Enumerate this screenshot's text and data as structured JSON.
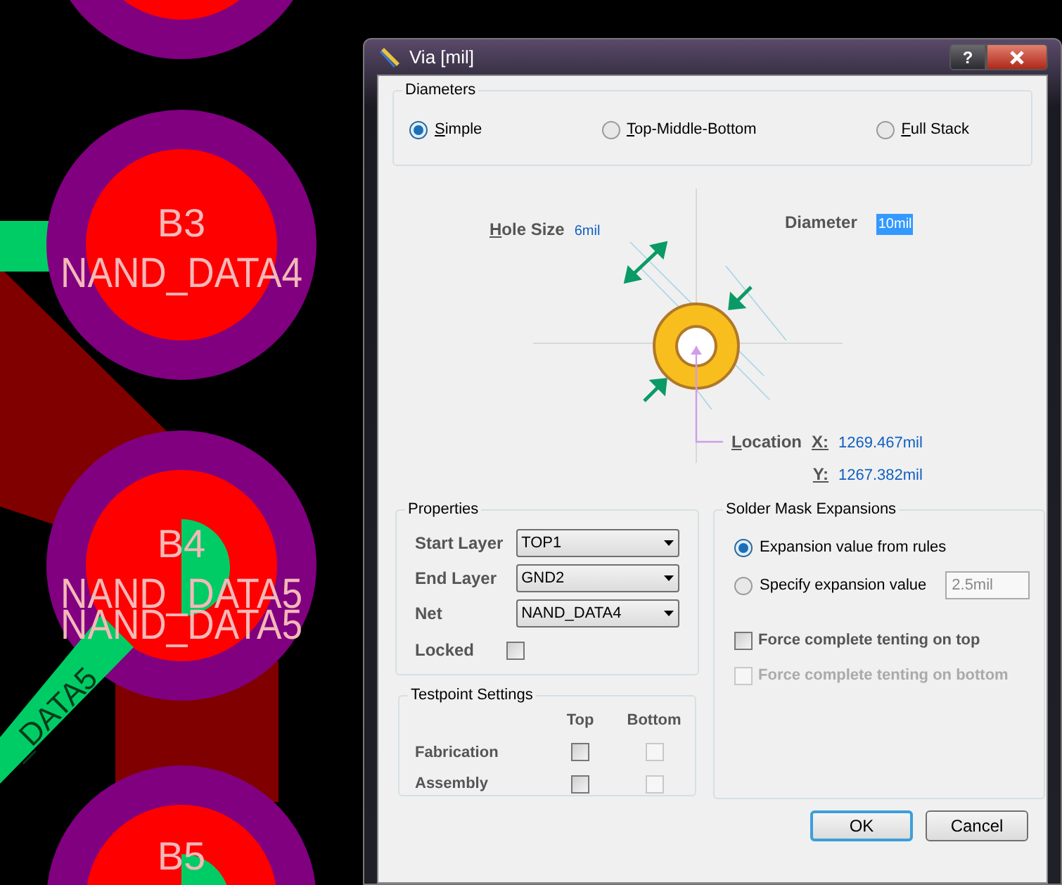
{
  "pcb": {
    "pads": [
      {
        "designator": "B3",
        "nets": [
          "NAND_DATA4"
        ]
      },
      {
        "designator": "B4",
        "nets": [
          "NAND_DATA5",
          "NAND_DATA5"
        ]
      },
      {
        "designator": "B5"
      }
    ],
    "trace_label": "_DATA5"
  },
  "window": {
    "title": "Via [mil]",
    "help": "?"
  },
  "diameters": {
    "title": "Diameters",
    "options": [
      {
        "label": "Simple",
        "selected": true
      },
      {
        "label": "Top-Middle-Bottom",
        "selected": false
      },
      {
        "label": "Full Stack",
        "selected": false
      }
    ]
  },
  "graphic": {
    "hole_size": {
      "label": "Hole Size",
      "value": "6mil"
    },
    "diameter": {
      "label": "Diameter",
      "value": "10mil",
      "selected": true
    },
    "location": {
      "label": "Location",
      "x": {
        "label": "X:",
        "value": "1269.467mil"
      },
      "y": {
        "label": "Y:",
        "value": "1267.382mil"
      }
    }
  },
  "properties": {
    "title": "Properties",
    "fields": [
      {
        "label": "Start Layer",
        "value": "TOP1"
      },
      {
        "label": "End Layer",
        "value": "GND2"
      },
      {
        "label": "Net",
        "value": "NAND_DATA4"
      }
    ],
    "locked": {
      "label": "Locked",
      "checked": false
    }
  },
  "testpoint": {
    "title": "Testpoint Settings",
    "columns": [
      "Top",
      "Bottom"
    ],
    "rows": [
      {
        "label": "Fabrication",
        "top": {
          "checked": false,
          "disabled": false
        },
        "bottom": {
          "checked": false,
          "disabled": true
        }
      },
      {
        "label": "Assembly",
        "top": {
          "checked": false,
          "disabled": false
        },
        "bottom": {
          "checked": false,
          "disabled": true
        }
      }
    ]
  },
  "solder_mask": {
    "title": "Solder Mask Expansions",
    "options": [
      {
        "label": "Expansion value from rules",
        "selected": true
      },
      {
        "label": "Specify expansion value",
        "selected": false
      }
    ],
    "value": {
      "value": "2.5mil",
      "disabled": true
    },
    "checkboxes": [
      {
        "label": "Force complete tenting on top",
        "checked": false,
        "disabled": false
      },
      {
        "label": "Force complete tenting on bottom",
        "checked": false,
        "disabled": true
      }
    ]
  },
  "buttons": [
    {
      "label": "OK",
      "default": true
    },
    {
      "label": "Cancel",
      "default": false
    }
  ]
}
